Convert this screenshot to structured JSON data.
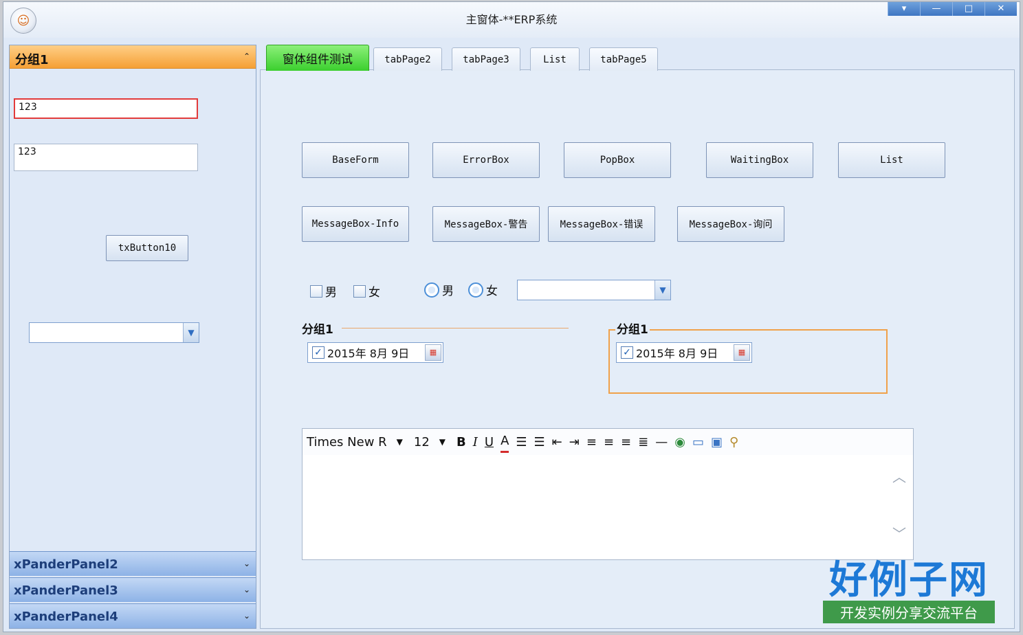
{
  "window": {
    "title": "主窗体-**ERP系统",
    "buttons": [
      "▾",
      "—",
      "□",
      "✕"
    ]
  },
  "left": {
    "group1": {
      "title": "分组1",
      "textbox1": "123",
      "textbox2": "123",
      "button": "txButton10",
      "combo_value": ""
    },
    "xpanders": [
      {
        "label": "xPanderPanel2"
      },
      {
        "label": "xPanderPanel3"
      },
      {
        "label": "xPanderPanel4"
      }
    ]
  },
  "tabs": [
    "窗体组件测试",
    "tabPage2",
    "tabPage3",
    "List",
    "tabPage5"
  ],
  "buttons_row1": [
    "BaseForm",
    "ErrorBox",
    "PopBox",
    "WaitingBox",
    "List"
  ],
  "buttons_row2": [
    "MessageBox-Info",
    "MessageBox-警告",
    "MessageBox-错误",
    "MessageBox-询问"
  ],
  "checks": [
    "男",
    "女"
  ],
  "radios": [
    "男",
    "女"
  ],
  "combo_value": "",
  "group_a": {
    "label": "分组1",
    "date": "2015年 8月 9日"
  },
  "group_b": {
    "label": "分组1",
    "date": "2015年 8月 9日"
  },
  "editor": {
    "font": "Times New R",
    "size": "12"
  },
  "watermark": {
    "big": "好例子网",
    "sub": "开发实例分享交流平台"
  },
  "colors": {
    "active_tab": "#3bcf2e",
    "group_header": "#f5a035",
    "error_border": "#e23a3a"
  }
}
